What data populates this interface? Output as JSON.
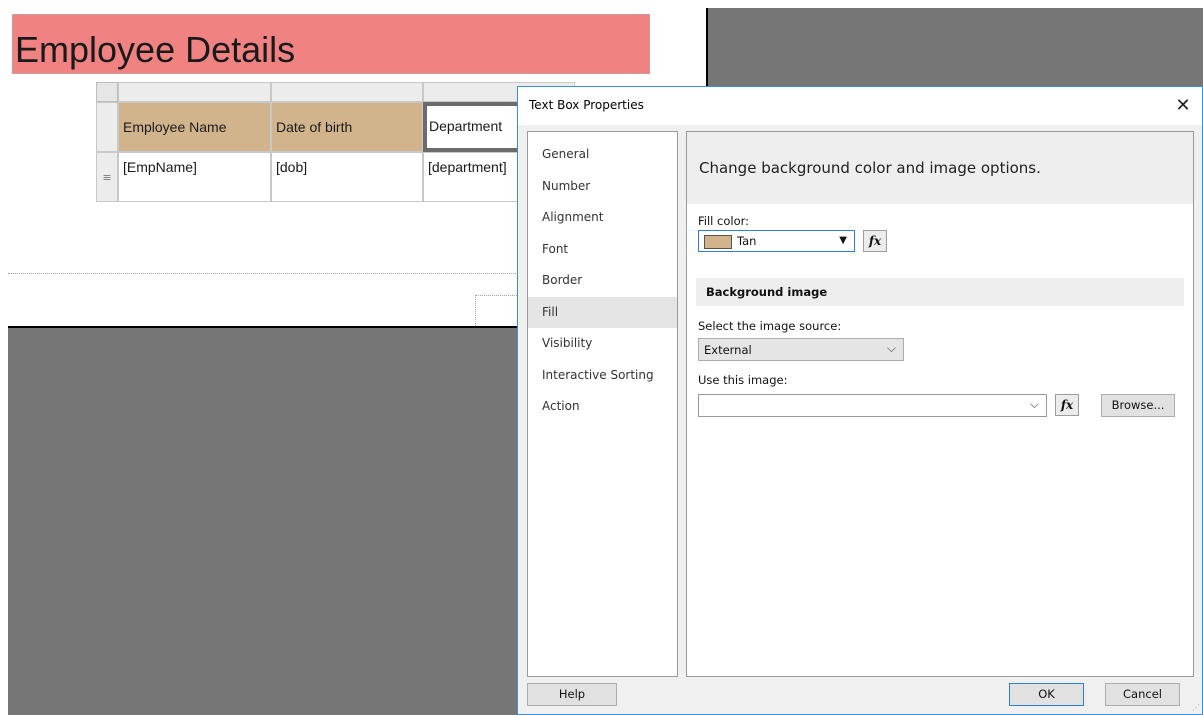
{
  "report": {
    "title": "Employee Details",
    "table": {
      "headers": [
        "Employee Name",
        "Date of birth",
        "Department"
      ],
      "row": [
        "[EmpName]",
        "[dob]",
        "[department]"
      ],
      "row_handle_icon": "≡"
    }
  },
  "dialog": {
    "title": "Text Box Properties",
    "close_label": "✕",
    "nav": [
      {
        "label": "General"
      },
      {
        "label": "Number"
      },
      {
        "label": "Alignment"
      },
      {
        "label": "Font"
      },
      {
        "label": "Border"
      },
      {
        "label": "Fill",
        "selected": true
      },
      {
        "label": "Visibility"
      },
      {
        "label": "Interactive Sorting"
      },
      {
        "label": "Action"
      }
    ],
    "panel": {
      "header": "Change background color and image options.",
      "fill_color_label": "Fill color:",
      "fill_color_value": "Tan",
      "fill_color_swatch": "#d2b48c",
      "fx_label": "fx",
      "section_title": "Background image",
      "image_source_label": "Select the image source:",
      "image_source_value": "External",
      "use_image_label": "Use this image:",
      "use_image_value": "",
      "browse_label": "Browse..."
    },
    "buttons": {
      "help": "Help",
      "ok": "OK",
      "cancel": "Cancel"
    }
  },
  "colors": {
    "title_background": "#f08282",
    "header_fill_tan": "#d2b48c",
    "canvas_background": "#767676",
    "dialog_accent": "#2f7fd0"
  },
  "icons": {
    "close": "close-icon",
    "dropdown_solid": "triangle-down-icon",
    "dropdown_chevron": "chevron-down-icon",
    "expression": "fx-icon",
    "row_handle": "row-handle-icon"
  }
}
